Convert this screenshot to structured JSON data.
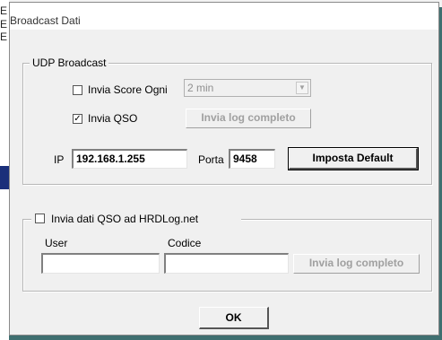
{
  "dialog": {
    "title": "Broadcast Dati"
  },
  "udp": {
    "group_label": "UDP Broadcast",
    "send_score_label": "Invia Score Ogni",
    "send_score_checked": false,
    "interval_value": "2 min",
    "send_qso_label": "Invia QSO",
    "send_qso_checked": true,
    "send_full_log_label": "Invia log completo",
    "ip_label": "IP",
    "ip_value": "192.168.1.255",
    "port_label": "Porta",
    "port_value": "9458",
    "default_button_label": "Imposta Default"
  },
  "hrdlog": {
    "group_label": "Invia dati QSO ad HRDLog.net",
    "enabled_checked": false,
    "user_label": "User",
    "user_value": "",
    "code_label": "Codice",
    "code_value": "",
    "send_full_log_label": "Invia log completo"
  },
  "footer": {
    "ok_label": "OK"
  },
  "icons": {
    "check": "✓",
    "dropdown": "▼"
  }
}
